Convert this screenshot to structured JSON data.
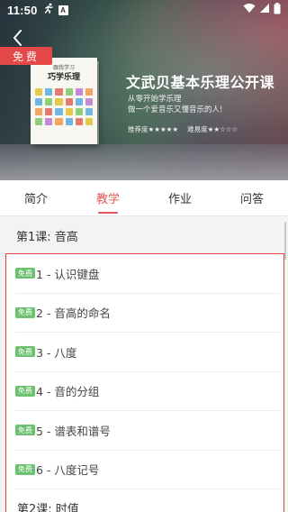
{
  "status_bar": {
    "time": "11:50"
  },
  "banner": {
    "free_label": "免费",
    "book": {
      "title": "跟我学习",
      "subtitle": "巧学乐理"
    },
    "course_title": "文武贝基本乐理公开课",
    "subtitle_line1": "从零开始学乐理",
    "subtitle_line2": "做一个爱音乐又懂音乐的人!",
    "recommend_label": "推荐度★★★★★",
    "difficulty_label": "难易度★★☆☆☆"
  },
  "tabs": [
    {
      "label": "简介"
    },
    {
      "label": "教学",
      "active": true
    },
    {
      "label": "作业"
    },
    {
      "label": "问答"
    }
  ],
  "sections": [
    {
      "title": "第1课: 音高",
      "lessons": [
        {
          "badge": "免费",
          "label": "1 - 认识键盘"
        },
        {
          "badge": "免费",
          "label": "2 - 音高的命名"
        },
        {
          "badge": "免费",
          "label": "3 - 八度"
        },
        {
          "badge": "免费",
          "label": "4 - 音的分组"
        },
        {
          "badge": "免费",
          "label": "5 - 谱表和谱号"
        },
        {
          "badge": "免费",
          "label": "6 - 八度记号"
        }
      ]
    },
    {
      "title": "第2课: 时值"
    }
  ],
  "colors": {
    "accent": "#e45757",
    "badge": "#6cc16f",
    "highlight_border": "#e44040"
  }
}
